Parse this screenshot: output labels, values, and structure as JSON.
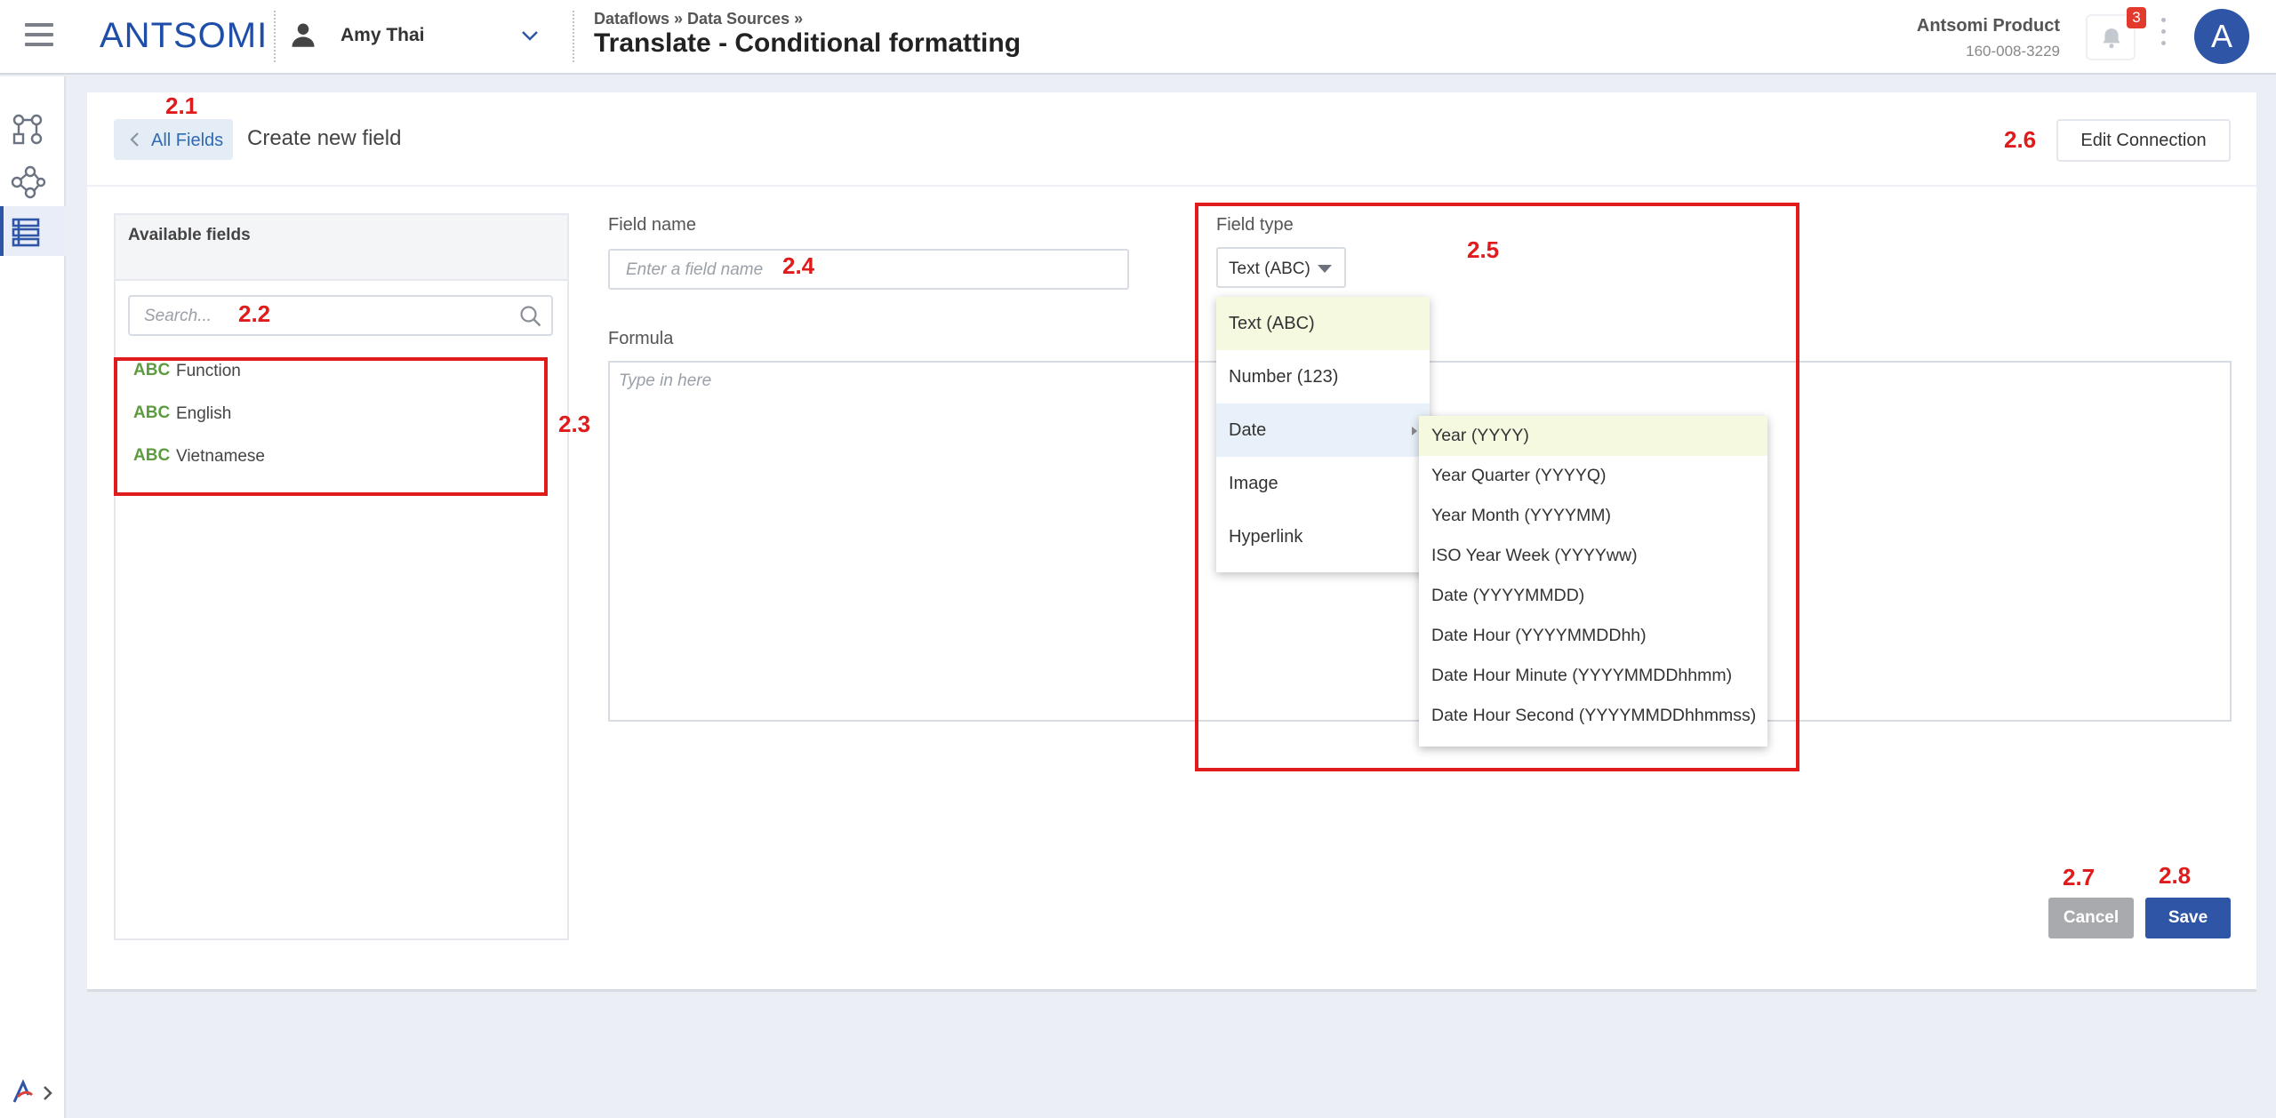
{
  "header": {
    "logo_text": "ANTSOMI",
    "user_name": "Amy Thai",
    "breadcrumb": "Dataflows » Data Sources »",
    "page_title": "Translate - Conditional formatting",
    "account_name": "Antsomi Product",
    "account_id": "160-008-3229",
    "notification_count": "3",
    "avatar_letter": "A"
  },
  "rail": {
    "items": [
      {
        "icon": "workflow-icon"
      },
      {
        "icon": "share-nodes-icon"
      },
      {
        "icon": "data-sources-icon",
        "active": true
      }
    ],
    "bottom_icon": "antsomi-logo-icon"
  },
  "toolbar": {
    "back_label": "All Fields",
    "title": "Create new field",
    "edit_connection_label": "Edit Connection"
  },
  "available_fields": {
    "title": "Available fields",
    "search_placeholder": "Search...",
    "items": [
      {
        "type": "ABC",
        "name": "Function"
      },
      {
        "type": "ABC",
        "name": "English"
      },
      {
        "type": "ABC",
        "name": "Vietnamese"
      }
    ]
  },
  "form": {
    "field_name_label": "Field name",
    "field_name_placeholder": "Enter a field name",
    "field_type_label": "Field type",
    "field_type_value": "Text (ABC)",
    "formula_label": "Formula",
    "formula_placeholder": "Type in here"
  },
  "type_dropdown": {
    "options": [
      "Text (ABC)",
      "Number (123)",
      "Date",
      "Image",
      "Hyperlink"
    ],
    "selected": "Text (ABC)",
    "hovered": "Date"
  },
  "date_submenu": {
    "options": [
      "Year (YYYY)",
      "Year Quarter (YYYYQ)",
      "Year Month (YYYYMM)",
      "ISO Year Week (YYYYww)",
      "Date (YYYYMMDD)",
      "Date Hour (YYYYMMDDhh)",
      "Date Hour Minute (YYYYMMDDhhmm)",
      "Date Hour Second (YYYYMMDDhhmmss)"
    ],
    "selected": "Year (YYYY)"
  },
  "actions": {
    "cancel_label": "Cancel",
    "save_label": "Save"
  },
  "annotations": {
    "a2_1": "2.1",
    "a2_2": "2.2",
    "a2_3": "2.3",
    "a2_4": "2.4",
    "a2_5": "2.5",
    "a2_6": "2.6",
    "a2_7": "2.7",
    "a2_8": "2.8"
  },
  "colors": {
    "brand": "#2f56a6",
    "annotation_red": "#e01b1b",
    "field_type_green": "#5c9c3e",
    "selected_bg": "#f5f9e0",
    "hover_bg": "#e8f0fa"
  }
}
